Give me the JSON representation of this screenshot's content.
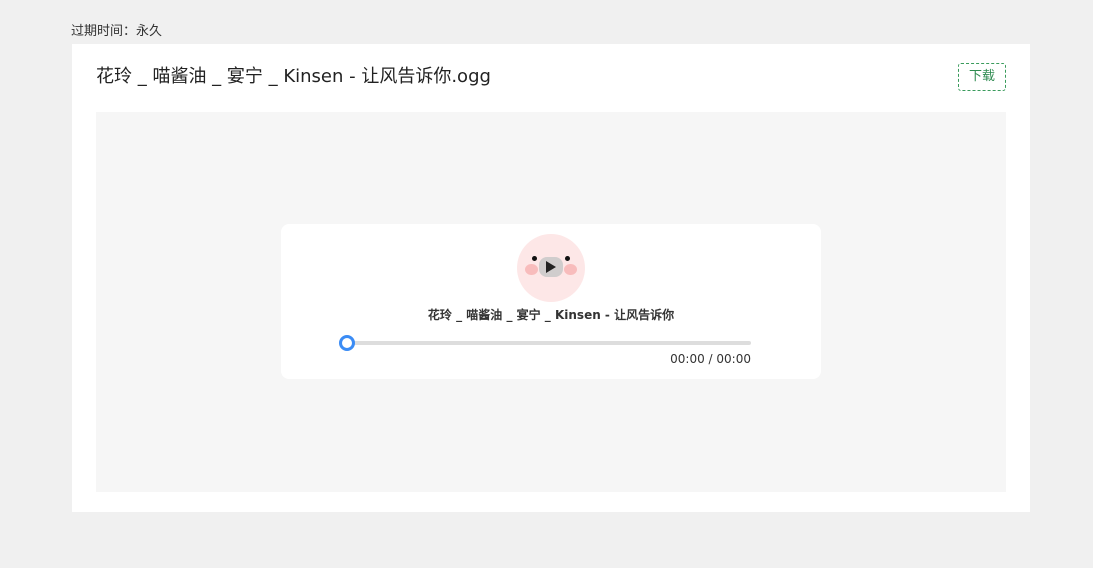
{
  "expire": {
    "text": "过期时间：永久"
  },
  "file": {
    "title": "花玲 _ 喵酱油 _ 宴宁 _ Kinsen - 让风告诉你.ogg"
  },
  "download": {
    "label": "下载"
  },
  "player": {
    "track_title": "花玲 _ 喵酱油 _ 宴宁 _ Kinsen - 让风告诉你",
    "current_time": "00:00",
    "separator": " / ",
    "duration": "00:00",
    "time_display": "00:00 / 00:00",
    "progress_fraction": 0,
    "cover_icon": "cute-face-icon",
    "play_icon": "play-icon"
  },
  "colors": {
    "accent": "#3b8cf5",
    "download_green": "#2e8b50",
    "cover_pink": "#fde7e7"
  }
}
